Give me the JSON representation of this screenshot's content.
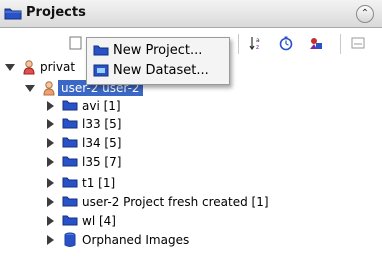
{
  "header": {
    "title": "Projects"
  },
  "menu": {
    "items": [
      {
        "label": "New Project..."
      },
      {
        "label": "New Dataset..."
      }
    ]
  },
  "tree": {
    "root_label": "privat",
    "user_label": "user-2 user-2",
    "items": [
      {
        "label": "avi [1]"
      },
      {
        "label": "l33 [5]"
      },
      {
        "label": "l34 [5]"
      },
      {
        "label": "l35 [7]"
      },
      {
        "label": "t1 [1]"
      },
      {
        "label": "user-2 Project fresh created [1]"
      },
      {
        "label": "wl [4]"
      },
      {
        "label": "Orphaned Images"
      }
    ]
  },
  "colors": {
    "selection": "#3b68c6",
    "folder": "#2a52c8"
  },
  "icons": {
    "header": "folder-icon",
    "collapse": "double-chevron-up-icon",
    "sort": "sort-az-icon",
    "refresh": "stopwatch-icon",
    "import": "import-icon",
    "user": "user-icon",
    "dataset": "folder-icon",
    "orphaned": "database-icon"
  }
}
